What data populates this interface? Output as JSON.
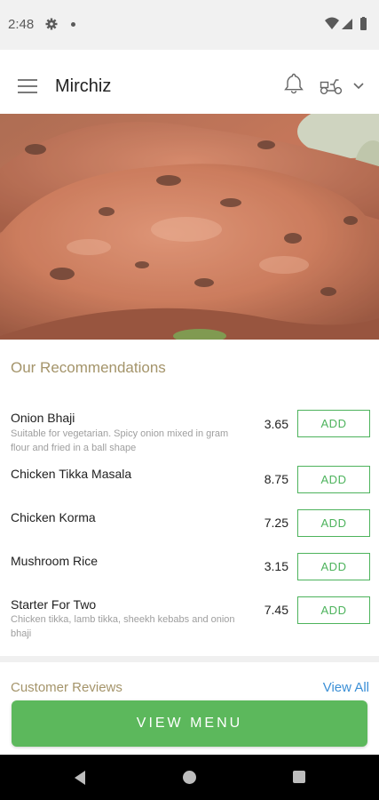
{
  "status_bar": {
    "time": "2:48",
    "icons": [
      "gear-icon",
      "notification-dot",
      "wifi-icon",
      "signal-icon",
      "battery-icon"
    ]
  },
  "app_bar": {
    "title": "Mirchiz",
    "icons": [
      "menu-icon",
      "bell-icon",
      "delivery-scooter-icon",
      "chevron-down-icon"
    ]
  },
  "hero": {
    "image": "tandoori-chicken-photo"
  },
  "recommendations": {
    "title": "Our Recommendations",
    "items": [
      {
        "name": "Onion Bhaji",
        "description": "Suitable for vegetarian. Spicy onion mixed in gram flour and fried in a ball shape",
        "price": "3.65",
        "button": "ADD"
      },
      {
        "name": "Chicken Tikka Masala",
        "description": "",
        "price": "8.75",
        "button": "ADD"
      },
      {
        "name": "Chicken Korma",
        "description": "",
        "price": "7.25",
        "button": "ADD"
      },
      {
        "name": "Mushroom Rice",
        "description": "",
        "price": "3.15",
        "button": "ADD"
      },
      {
        "name": "Starter For Two",
        "description": "Chicken tikka, lamb tikka, sheekh kebabs and onion bhaji",
        "price": "7.45",
        "button": "ADD"
      }
    ]
  },
  "reviews": {
    "title": "Customer Reviews",
    "view_all": "View All"
  },
  "cta": {
    "label": "VIEW MENU"
  },
  "colors": {
    "accent_green": "#4db35c",
    "section_title": "#a4946a",
    "link_blue": "#3b8fd6",
    "cta_green": "#5cb85c"
  }
}
